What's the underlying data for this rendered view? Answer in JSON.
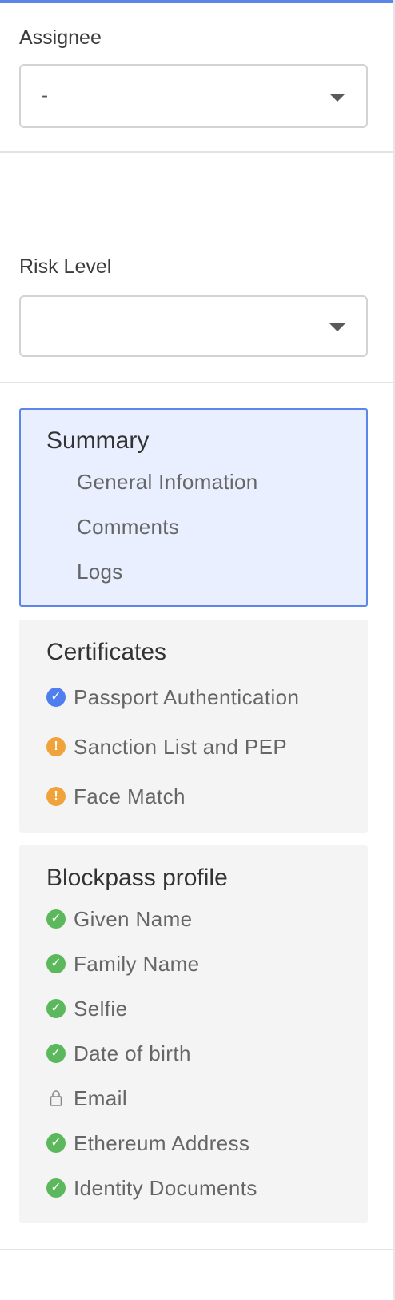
{
  "assignee": {
    "label": "Assignee",
    "value": "-"
  },
  "risk_level": {
    "label": "Risk Level",
    "value": ""
  },
  "summary": {
    "title": "Summary",
    "items": [
      "General Infomation",
      "Comments",
      "Logs"
    ]
  },
  "certificates": {
    "title": "Certificates",
    "items": [
      {
        "label": "Passport Authentication",
        "status": "verified",
        "icon": "check-circle-blue-icon"
      },
      {
        "label": "Sanction List and PEP",
        "status": "warning",
        "icon": "warning-circle-icon"
      },
      {
        "label": "Face Match",
        "status": "warning",
        "icon": "warning-circle-icon"
      }
    ]
  },
  "blockpass_profile": {
    "title": "Blockpass profile",
    "items": [
      {
        "label": "Given Name",
        "status": "ok",
        "icon": "check-circle-green-icon"
      },
      {
        "label": "Family Name",
        "status": "ok",
        "icon": "check-circle-green-icon"
      },
      {
        "label": "Selfie",
        "status": "ok",
        "icon": "check-circle-green-icon"
      },
      {
        "label": "Date of birth",
        "status": "ok",
        "icon": "check-circle-green-icon"
      },
      {
        "label": "Email",
        "status": "locked",
        "icon": "lock-icon"
      },
      {
        "label": "Ethereum Address",
        "status": "ok",
        "icon": "check-circle-green-icon"
      },
      {
        "label": "Identity Documents",
        "status": "ok",
        "icon": "check-circle-green-icon"
      }
    ]
  },
  "colors": {
    "accent": "#5b86ea",
    "success": "#5cb85c",
    "warning": "#f0a33a",
    "active_bg": "#e9efff"
  }
}
